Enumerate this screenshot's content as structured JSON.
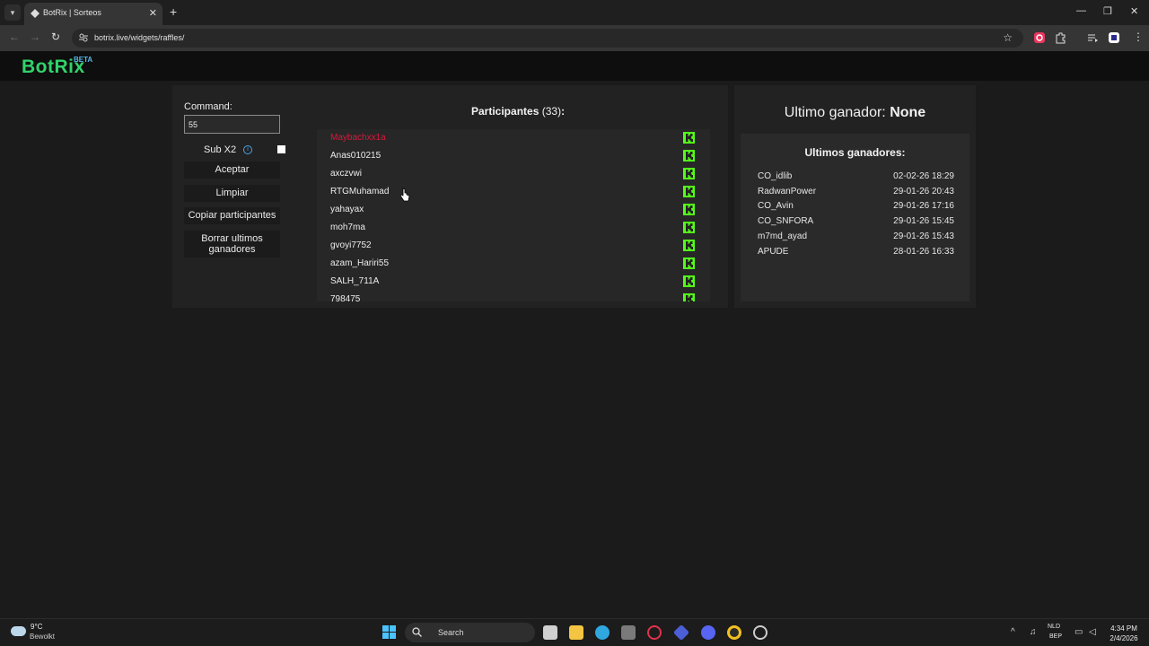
{
  "browser": {
    "tab_title": "BotRix | Sorteos",
    "url": "botrix.live/widgets/raffles/"
  },
  "site": {
    "logo": "BotRix",
    "badge": "BETA"
  },
  "controls": {
    "command_label": "Command:",
    "command_value": "55",
    "sub_label": "Sub X2",
    "sub_checked": false,
    "btn_accept": "Aceptar",
    "btn_clear": "Limpiar",
    "btn_copy": "Copiar participantes",
    "btn_delete": "Borrar ultimos ganadores"
  },
  "participants": {
    "title": "Participantes",
    "count": "(33)",
    "colon": ":",
    "items": [
      {
        "name": "Maybachxx1a",
        "highlight": true
      },
      {
        "name": "Anas010215",
        "highlight": false
      },
      {
        "name": "axczvwi",
        "highlight": false
      },
      {
        "name": "RTGMuhamad",
        "highlight": false
      },
      {
        "name": "yahayax",
        "highlight": false
      },
      {
        "name": "moh7ma",
        "highlight": false
      },
      {
        "name": "gvoyi7752",
        "highlight": false
      },
      {
        "name": "azam_Hariri55",
        "highlight": false
      },
      {
        "name": "SALH_711A",
        "highlight": false
      },
      {
        "name": "798475",
        "highlight": false
      }
    ]
  },
  "winner": {
    "label": "Ultimo ganador:",
    "value": "None"
  },
  "recent_winners": {
    "title": "Ultimos ganadores:",
    "items": [
      {
        "name": "CO_idlib",
        "date": "02-02-26 18:29"
      },
      {
        "name": "RadwanPower",
        "date": "29-01-26 20:43"
      },
      {
        "name": "CO_Avin",
        "date": "29-01-26 17:16"
      },
      {
        "name": "CO_SNFORA",
        "date": "29-01-26 15:45"
      },
      {
        "name": "m7md_ayad",
        "date": "29-01-26 15:43"
      },
      {
        "name": "APUDE",
        "date": "28-01-26 16:33"
      }
    ]
  },
  "taskbar": {
    "temperature": "9°C",
    "condition": "Bewolkt",
    "search_placeholder": "Search",
    "lang_top": "NLD",
    "lang_bottom": "BEP",
    "time": "4:34 PM",
    "date": "2/4/2026"
  },
  "colors": {
    "brand_green": "#31d36b",
    "kick_green": "#53fc18",
    "highlight_red": "#d61a3c"
  }
}
